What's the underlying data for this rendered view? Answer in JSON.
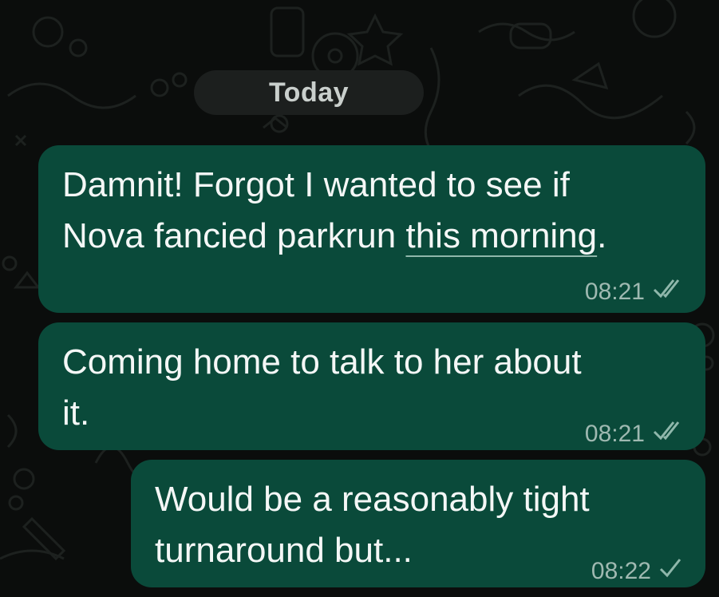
{
  "date_separator": "Today",
  "messages": [
    {
      "lines": [
        "Damnit! Forgot I wanted to see if",
        "Nova fancied parkrun this morning."
      ],
      "link_text": "this morning",
      "time": "08:21",
      "status": "read-double-check-icon"
    },
    {
      "lines": [
        "Coming home to talk to her about",
        "it."
      ],
      "time": "08:21",
      "status": "read-double-check-icon"
    },
    {
      "lines": [
        "Would be a reasonably tight",
        "turnaround but..."
      ],
      "time": "08:22",
      "status": "sent-single-check-icon"
    }
  ],
  "colors": {
    "background": "#0b0d0c",
    "bubble": "#0a4a3a",
    "date_pill": "#1c1f1e",
    "meta_text": "#9fb9b1"
  }
}
